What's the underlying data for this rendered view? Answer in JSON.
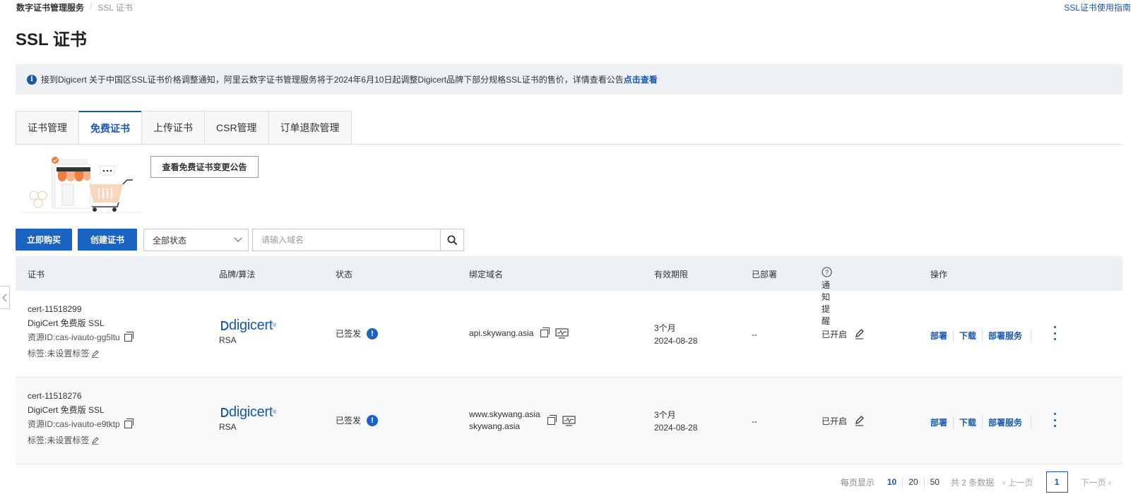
{
  "breadcrumb": {
    "root": "数字证书管理服务",
    "sep": "/",
    "current": "SSL 证书"
  },
  "guide_link": "SSL证书使用指南",
  "page_title": "SSL 证书",
  "notice": {
    "text": "接到Digicert 关于中国区SSL证书价格调整通知，阿里云数字证书管理服务将于2024年6月10日起调整Digicert品牌下部分规格SSL证书的售价，详情查看公告",
    "link": "点击查看"
  },
  "tabs": [
    {
      "label": "证书管理"
    },
    {
      "label": "免费证书",
      "active": true
    },
    {
      "label": "上传证书"
    },
    {
      "label": "CSR管理"
    },
    {
      "label": "订单退款管理"
    }
  ],
  "notice_button": "查看免费证书变更公告",
  "toolbar": {
    "buy": "立即购买",
    "create": "创建证书",
    "status_select": "全部状态",
    "search_placeholder": "请输入域名"
  },
  "columns": {
    "cert": "证书",
    "brand": "品牌/算法",
    "status": "状态",
    "domain": "绑定域名",
    "validity": "有效期限",
    "deployed": "已部署",
    "notify": "通知提醒",
    "ops": "操作"
  },
  "rows": [
    {
      "cert_id": "cert-11518299",
      "cert_name": "DigiCert 免费版 SSL",
      "resource": "资源ID:cas-ivauto-gg5ltu",
      "tag": "标签:未设置标签",
      "brand": "digicert",
      "algo": "RSA",
      "status": "已签发",
      "domain1": "api.skywang.asia",
      "domain2": "",
      "validity_period": "3个月",
      "validity_date": "2024-08-28",
      "deployed": "--",
      "notify": "已开启"
    },
    {
      "cert_id": "cert-11518276",
      "cert_name": "DigiCert 免费版 SSL",
      "resource": "资源ID:cas-ivauto-e9tktp",
      "tag": "标签:未设置标签",
      "brand": "digicert",
      "algo": "RSA",
      "status": "已签发",
      "domain1": "www.skywang.asia",
      "domain2": "skywang.asia",
      "validity_period": "3个月",
      "validity_date": "2024-08-28",
      "deployed": "--",
      "notify": "已开启"
    }
  ],
  "ops": {
    "deploy": "部署",
    "download": "下载",
    "deploy_service": "部署服务"
  },
  "pager": {
    "per_page_label": "每页显示",
    "sizes": [
      "10",
      "20",
      "50"
    ],
    "total": "共 2 条数据",
    "prev": "上一页",
    "page": "1",
    "next": "下一页"
  },
  "colors": {
    "accent": "#1a5aa8",
    "primary_button": "#1a63c3",
    "notice_bg": "#edf1f6"
  }
}
